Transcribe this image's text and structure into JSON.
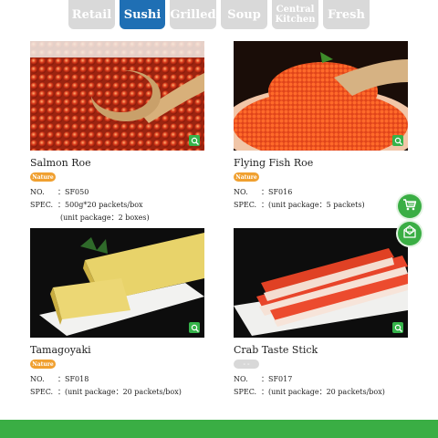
{
  "tabs": [
    {
      "label": "Retail"
    },
    {
      "label": "Sushi"
    },
    {
      "label": "Grilled"
    },
    {
      "label": "Soup"
    },
    {
      "label": "Central Kitchen"
    },
    {
      "label": "Fresh"
    }
  ],
  "products": [
    {
      "name": "Salmon Roe",
      "badge": "Nature",
      "no_label": "NO.",
      "no_sep": "：",
      "no_value": "SF050",
      "spec_label": "SPEC.",
      "spec_sep": "：",
      "spec_value": "500g*20 packets/box",
      "spec_extra": "(unit package：2 boxes)"
    },
    {
      "name": "Flying Fish Roe",
      "badge": "Nature",
      "no_label": "NO.",
      "no_sep": "：",
      "no_value": "SF016",
      "spec_label": "SPEC.",
      "spec_sep": "：",
      "spec_value": "(unit package：5 packets)"
    },
    {
      "name": "Tamagoyaki",
      "badge": "Nature",
      "no_label": "NO.",
      "no_sep": "：",
      "no_value": "SF018",
      "spec_label": "SPEC.",
      "spec_sep": "：",
      "spec_value": "(unit package：20 packets/box)"
    },
    {
      "name": "Crab Taste Stick",
      "badge": "- -",
      "no_label": "NO.",
      "no_sep": "：",
      "no_value": "SF017",
      "spec_label": "SPEC.",
      "spec_sep": "：",
      "spec_value": "(unit package：20 packets/box)"
    }
  ],
  "colors": {
    "active_tab": "#1f6fb4",
    "inactive_tab": "#d9d9d9",
    "badge": "#f0a030",
    "accent_green": "#3aae44"
  },
  "icons": {
    "zoom": "zoom-in-icon",
    "cart": "cart-icon",
    "mail": "mail-icon"
  }
}
